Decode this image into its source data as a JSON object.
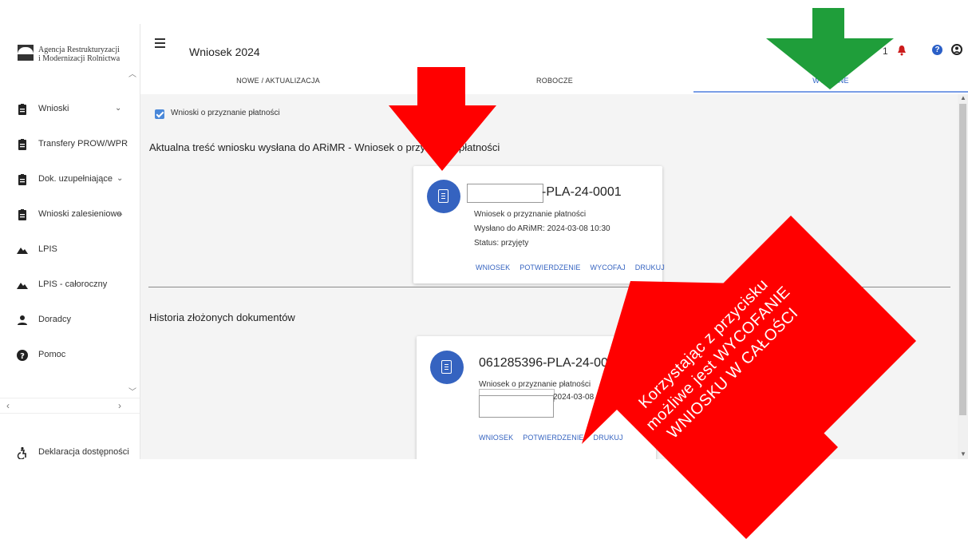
{
  "org": {
    "line1": "Agencja Restrukturyzacji",
    "line2": "i Modernizacji Rolnictwa"
  },
  "sidebar": {
    "items": [
      {
        "label": "Wnioski",
        "icon": "clipboard-icon",
        "has_chevron": true
      },
      {
        "label": "Transfery PROW/WPR",
        "icon": "clipboard-icon"
      },
      {
        "label": "Dok. uzupełniające",
        "icon": "clipboard-icon",
        "has_chevron": true
      },
      {
        "label": "Wnioski zalesieniowe",
        "icon": "clipboard-icon",
        "has_chevron": true
      },
      {
        "label": "LPIS",
        "icon": "terrain-icon"
      },
      {
        "label": "LPIS - całoroczny",
        "icon": "terrain-icon"
      },
      {
        "label": "Doradcy",
        "icon": "person-icon"
      },
      {
        "label": "Pomoc",
        "icon": "help-icon"
      }
    ],
    "accessibility": "Deklaracja dostępności"
  },
  "header": {
    "title": "Wniosek 2024",
    "notification_count": "1"
  },
  "tabs": [
    {
      "label": "NOWE / AKTUALIZACJA"
    },
    {
      "label": "ROBOCZE"
    },
    {
      "label": "WYSŁANE",
      "active": true
    }
  ],
  "filter": {
    "label": "Wnioski o przyznanie płatności",
    "checked": true
  },
  "current": {
    "title": "Aktualna treść wniosku wysłana do ARiMR - Wniosek o przyznanie płatności",
    "card": {
      "id": "-PLA-24-0001",
      "type": "Wniosek o przyznanie płatności",
      "sent": "Wysłano do ARiMR: 2024-03-08 10:30",
      "status": "Status: przyjęty",
      "actions": [
        "WNIOSEK",
        "POTWIERDZENIE",
        "WYCOFAJ",
        "DRUKUJ"
      ]
    }
  },
  "history": {
    "title": "Historia złożonych dokumentów",
    "card": {
      "id": "061285396-PLA-24-0001",
      "type": "Wniosek o przyznanie płatności",
      "sent": "2024-03-08 10:30",
      "actions": [
        "WNIOSEK",
        "POTWIERDZENIE",
        "DRUKUJ"
      ]
    }
  },
  "annotation": {
    "text_line1": "Korzystając z przycisku",
    "text_line2": "możliwe jest WYCOFANIE",
    "text_line3": "WNIOSKU W CAŁOŚCI",
    "red": "#ff0000",
    "green": "#1f9e3a"
  },
  "colors": {
    "accent": "#3563c0",
    "tab_active": "#2e63c6"
  }
}
